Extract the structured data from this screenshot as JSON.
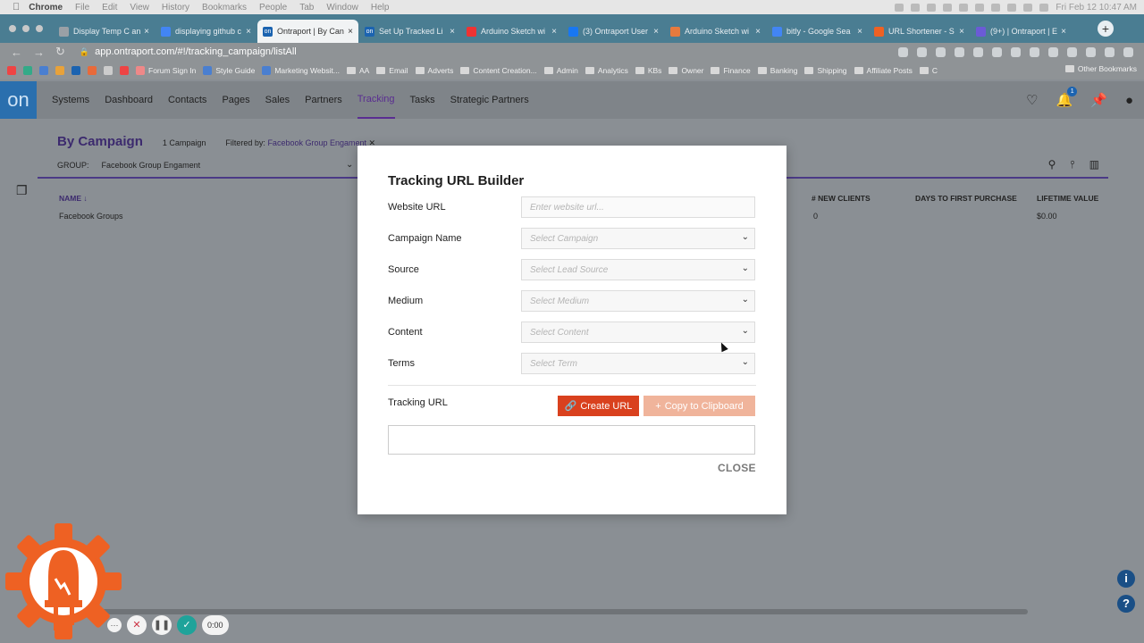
{
  "macbar": {
    "app": "Chrome",
    "menus": [
      "File",
      "Edit",
      "View",
      "History",
      "Bookmarks",
      "People",
      "Tab",
      "Window",
      "Help"
    ],
    "clock": "Fri Feb 12  10:47 AM"
  },
  "tabs": [
    {
      "label": "Display Temp C an",
      "active": false,
      "color": "#9aa0a6"
    },
    {
      "label": "displaying github c",
      "active": false,
      "color": "#4285f4"
    },
    {
      "label": "Ontraport | By Can",
      "active": true,
      "color": "#1b63b0"
    },
    {
      "label": "Set Up Tracked Li",
      "active": false,
      "color": "#1b63b0"
    },
    {
      "label": "Arduino Sketch wi",
      "active": false,
      "color": "#e33"
    },
    {
      "label": "(3) Ontraport User",
      "active": false,
      "color": "#1877f2"
    },
    {
      "label": "Arduino Sketch wi",
      "active": false,
      "color": "#e67a3e"
    },
    {
      "label": "bitly - Google Sea",
      "active": false,
      "color": "#4285f4"
    },
    {
      "label": "URL Shortener - S",
      "active": false,
      "color": "#ee6123"
    },
    {
      "label": "(9+) | Ontraport | E",
      "active": false,
      "color": "#6b5bd6"
    }
  ],
  "address": {
    "url": "app.ontraport.com/#!/tracking_campaign/listAll"
  },
  "bookmarks": [
    {
      "label": "Forum Sign In",
      "kind": "icon"
    },
    {
      "label": "Style Guide",
      "kind": "icon"
    },
    {
      "label": "Marketing Websit...",
      "kind": "icon"
    },
    {
      "label": "AA",
      "kind": "folder"
    },
    {
      "label": "Email",
      "kind": "folder"
    },
    {
      "label": "Adverts",
      "kind": "folder"
    },
    {
      "label": "Content Creation...",
      "kind": "folder"
    },
    {
      "label": "Admin",
      "kind": "folder"
    },
    {
      "label": "Analytics",
      "kind": "folder"
    },
    {
      "label": "KBs",
      "kind": "folder"
    },
    {
      "label": "Owner",
      "kind": "folder"
    },
    {
      "label": "Finance",
      "kind": "folder"
    },
    {
      "label": "Banking",
      "kind": "folder"
    },
    {
      "label": "Shipping",
      "kind": "folder"
    },
    {
      "label": "Affiliate Posts",
      "kind": "folder"
    },
    {
      "label": "C",
      "kind": "folder"
    }
  ],
  "bookmarks_other": "Other Bookmarks",
  "appnav": {
    "logo": "on",
    "items": [
      "Systems",
      "Dashboard",
      "Contacts",
      "Pages",
      "Sales",
      "Partners",
      "Tracking",
      "Tasks",
      "Strategic Partners"
    ],
    "selected": "Tracking",
    "notif_count": "1"
  },
  "page": {
    "heading": "By Campaign",
    "count": "1 Campaign",
    "filter_label": "Filtered by:",
    "filter_value": "Facebook Group Engament",
    "group_label": "GROUP:",
    "group_value": "Facebook Group Engament",
    "col_name": "NAME",
    "row_name": "Facebook Groups",
    "cols": [
      {
        "h": "# NEW CLIENTS",
        "v": "0"
      },
      {
        "h": "DAYS TO FIRST PURCHASE",
        "v": ""
      },
      {
        "h": "LIFETIME VALUE",
        "v": "$0.00"
      }
    ]
  },
  "modal": {
    "title": "Tracking URL Builder",
    "fields": [
      {
        "label": "Website URL",
        "placeholder": "Enter website url...",
        "type": "text"
      },
      {
        "label": "Campaign Name",
        "placeholder": "Select Campaign",
        "type": "select"
      },
      {
        "label": "Source",
        "placeholder": "Select Lead Source",
        "type": "select"
      },
      {
        "label": "Medium",
        "placeholder": "Select Medium",
        "type": "select"
      },
      {
        "label": "Content",
        "placeholder": "Select Content",
        "type": "select"
      },
      {
        "label": "Terms",
        "placeholder": "Select Term",
        "type": "select"
      }
    ],
    "tracking_label": "Tracking URL",
    "create_btn": "Create URL",
    "copy_btn": "Copy to Clipboard",
    "tracking_value": "",
    "close": "CLOSE"
  },
  "recorder": {
    "time": "0:00"
  },
  "colors": {
    "accent": "#5a2d91",
    "create": "#d9411e",
    "copy": "#f0b49b",
    "logo_bg": "#2a6fae"
  }
}
